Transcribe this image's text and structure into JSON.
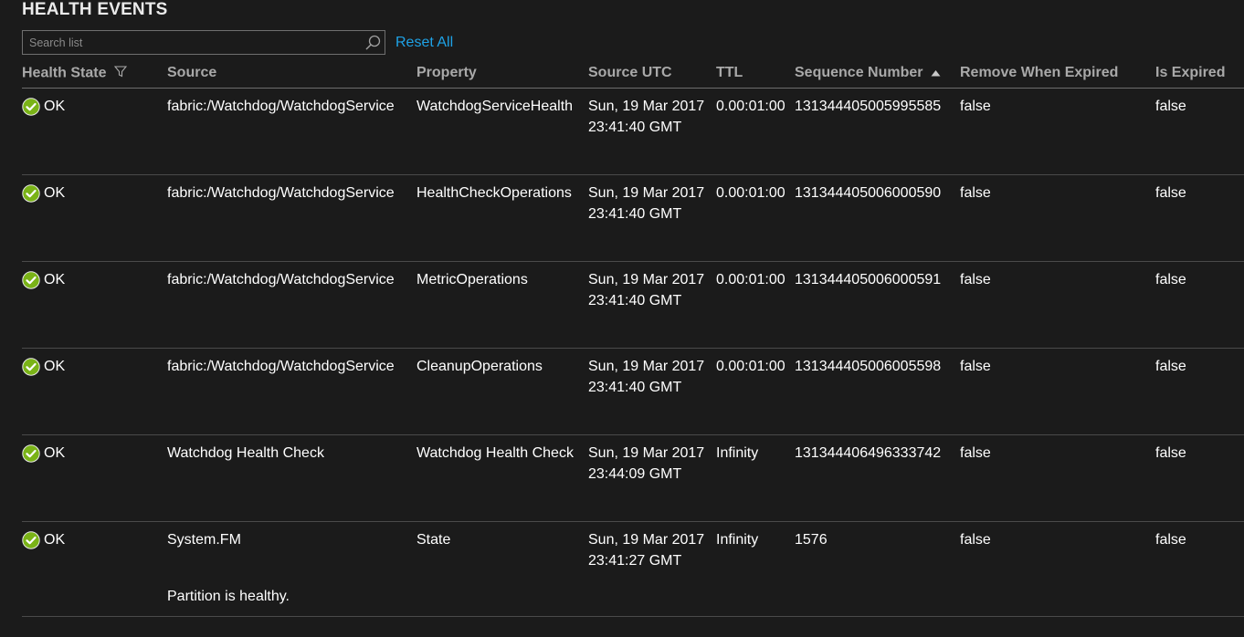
{
  "section": {
    "title": "HEALTH EVENTS"
  },
  "toolbar": {
    "search_placeholder": "Search list",
    "search_value": "",
    "reset_label": "Reset All"
  },
  "colors": {
    "accent": "#1ea2e6",
    "ok_green": "#7ab317",
    "background": "#1b1b1b"
  },
  "table": {
    "columns": [
      {
        "label": "Health State",
        "icon": "filter-icon"
      },
      {
        "label": "Source"
      },
      {
        "label": "Property"
      },
      {
        "label": "Source UTC"
      },
      {
        "label": "TTL"
      },
      {
        "label": "Sequence Number",
        "icon": "sort-ascending-icon"
      },
      {
        "label": "Remove When Expired"
      },
      {
        "label": "Is Expired"
      }
    ],
    "rows": [
      {
        "health_state": "OK",
        "state_icon": "ok-check-icon",
        "source": "fabric:/Watchdog/WatchdogService",
        "property": "WatchdogServiceHealth",
        "source_utc": "Sun, 19 Mar 2017 23:41:40 GMT",
        "ttl": "0.00:01:00",
        "sequence_number": "131344405005995585",
        "remove_when_expired": "false",
        "is_expired": "false",
        "description": ""
      },
      {
        "health_state": "OK",
        "state_icon": "ok-check-icon",
        "source": "fabric:/Watchdog/WatchdogService",
        "property": "HealthCheckOperations",
        "source_utc": "Sun, 19 Mar 2017 23:41:40 GMT",
        "ttl": "0.00:01:00",
        "sequence_number": "131344405006000590",
        "remove_when_expired": "false",
        "is_expired": "false",
        "description": ""
      },
      {
        "health_state": "OK",
        "state_icon": "ok-check-icon",
        "source": "fabric:/Watchdog/WatchdogService",
        "property": "MetricOperations",
        "source_utc": "Sun, 19 Mar 2017 23:41:40 GMT",
        "ttl": "0.00:01:00",
        "sequence_number": "131344405006000591",
        "remove_when_expired": "false",
        "is_expired": "false",
        "description": ""
      },
      {
        "health_state": "OK",
        "state_icon": "ok-check-icon",
        "source": "fabric:/Watchdog/WatchdogService",
        "property": "CleanupOperations",
        "source_utc": "Sun, 19 Mar 2017 23:41:40 GMT",
        "ttl": "0.00:01:00",
        "sequence_number": "131344405006005598",
        "remove_when_expired": "false",
        "is_expired": "false",
        "description": ""
      },
      {
        "health_state": "OK",
        "state_icon": "ok-check-icon",
        "source": "Watchdog Health Check",
        "property": "Watchdog Health Check",
        "source_utc": "Sun, 19 Mar 2017 23:44:09 GMT",
        "ttl": "Infinity",
        "sequence_number": "131344406496333742",
        "remove_when_expired": "false",
        "is_expired": "false",
        "description": ""
      },
      {
        "health_state": "OK",
        "state_icon": "ok-check-icon",
        "source": "System.FM",
        "property": "State",
        "source_utc": "Sun, 19 Mar 2017 23:41:27 GMT",
        "ttl": "Infinity",
        "sequence_number": "1576",
        "remove_when_expired": "false",
        "is_expired": "false",
        "description": "Partition is healthy."
      }
    ]
  }
}
